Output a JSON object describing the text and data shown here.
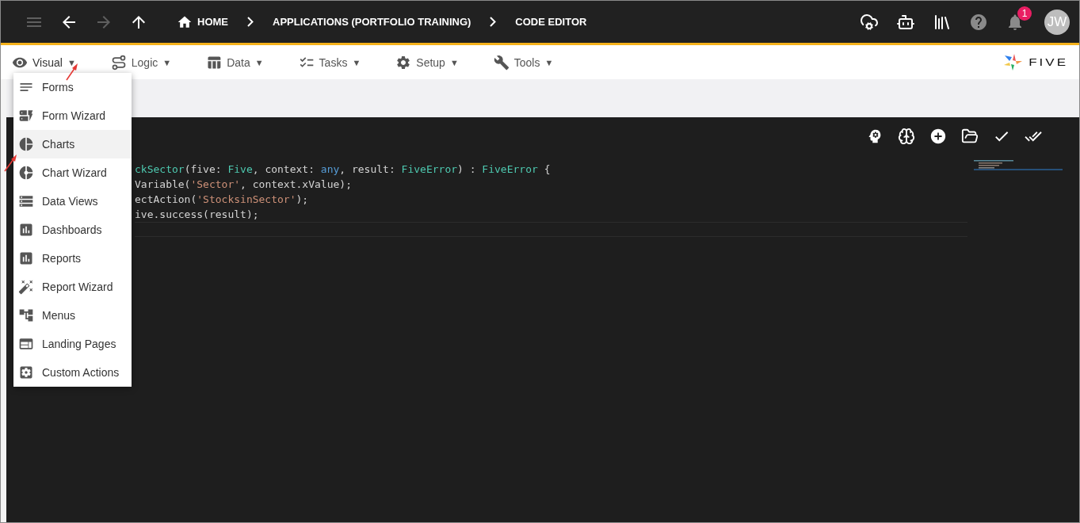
{
  "topbar": {
    "nav_buttons": [
      {
        "kind": "menu",
        "disabled": true
      },
      {
        "kind": "back",
        "disabled": false
      },
      {
        "kind": "forward",
        "disabled": true
      },
      {
        "kind": "up",
        "disabled": false
      }
    ],
    "breadcrumbs": [
      {
        "kind": "home",
        "label": "HOME"
      },
      {
        "kind": "plain",
        "label": "APPLICATIONS (PORTFOLIO TRAINING)"
      },
      {
        "kind": "plain",
        "label": "CODE EDITOR"
      }
    ],
    "actions": [
      {
        "kind": "cloud"
      },
      {
        "kind": "bot"
      },
      {
        "kind": "books"
      },
      {
        "kind": "help"
      },
      {
        "kind": "bell",
        "badge": "1"
      }
    ],
    "avatar": "JW"
  },
  "menubar": {
    "items": [
      {
        "kind": "visual",
        "label": "Visual",
        "caret": "▼",
        "open": true
      },
      {
        "kind": "logic",
        "label": "Logic",
        "caret": "▼",
        "open": false
      },
      {
        "kind": "data",
        "label": "Data",
        "caret": "▼",
        "open": false
      },
      {
        "kind": "tasks",
        "label": "Tasks",
        "caret": "▼",
        "open": false
      },
      {
        "kind": "setup",
        "label": "Setup",
        "caret": "▼",
        "open": false
      },
      {
        "kind": "tools",
        "label": "Tools",
        "caret": "▼",
        "open": false
      }
    ],
    "logo": "FIVE"
  },
  "dropdown": {
    "items": [
      {
        "kind": "forms",
        "label": "Forms",
        "selected": false
      },
      {
        "kind": "form_wizard",
        "label": "Form Wizard",
        "selected": false
      },
      {
        "kind": "charts",
        "label": "Charts",
        "selected": true
      },
      {
        "kind": "chart_wizard",
        "label": "Chart Wizard",
        "selected": false
      },
      {
        "kind": "data_views",
        "label": "Data Views",
        "selected": false
      },
      {
        "kind": "dashboards",
        "label": "Dashboards",
        "selected": false
      },
      {
        "kind": "reports",
        "label": "Reports",
        "selected": false
      },
      {
        "kind": "report_wizard",
        "label": "Report Wizard",
        "selected": false
      },
      {
        "kind": "menus",
        "label": "Menus",
        "selected": false
      },
      {
        "kind": "landing_pages",
        "label": "Landing Pages",
        "selected": false
      },
      {
        "kind": "custom_actions",
        "label": "Custom Actions",
        "selected": false
      }
    ]
  },
  "editor": {
    "toolbar": [
      {
        "kind": "help"
      },
      {
        "kind": "brain"
      },
      {
        "kind": "add"
      },
      {
        "kind": "open"
      },
      {
        "kind": "check"
      },
      {
        "kind": "check_all"
      }
    ],
    "lines": [
      [
        {
          "kind": "func",
          "text": "ckSector"
        },
        {
          "kind": "plain",
          "text": "(five: "
        },
        {
          "kind": "type",
          "text": "Five"
        },
        {
          "kind": "plain",
          "text": ", context: "
        },
        {
          "kind": "keyword",
          "text": "any"
        },
        {
          "kind": "plain",
          "text": ", result: "
        },
        {
          "kind": "type",
          "text": "FiveError"
        },
        {
          "kind": "plain",
          "text": ") : "
        },
        {
          "kind": "type",
          "text": "FiveError"
        },
        {
          "kind": "plain",
          "text": " {"
        }
      ],
      [
        {
          "kind": "plain",
          "text": "Variable("
        },
        {
          "kind": "string",
          "text": "'Sector'"
        },
        {
          "kind": "plain",
          "text": ", context.xValue);"
        }
      ],
      [
        {
          "kind": "plain",
          "text": "ectAction("
        },
        {
          "kind": "string",
          "text": "'StocksinSector'"
        },
        {
          "kind": "plain",
          "text": ");"
        }
      ],
      [
        {
          "kind": "plain",
          "text": "ive.success(result);"
        }
      ]
    ]
  }
}
